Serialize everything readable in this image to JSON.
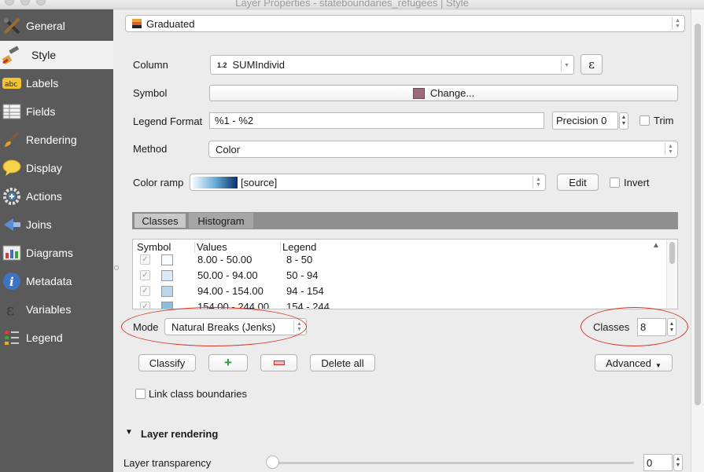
{
  "window": {
    "title": "Layer Properties - stateboundaries_refugees | Style"
  },
  "sidebar": {
    "items": [
      {
        "label": "General",
        "icon": "general-tools-icon"
      },
      {
        "label": "Style",
        "icon": "style-brush-icon",
        "active": true
      },
      {
        "label": "Labels",
        "icon": "labels-abc-icon"
      },
      {
        "label": "Fields",
        "icon": "fields-table-icon"
      },
      {
        "label": "Rendering",
        "icon": "rendering-brush-icon"
      },
      {
        "label": "Display",
        "icon": "display-speech-icon"
      },
      {
        "label": "Actions",
        "icon": "actions-gear-icon"
      },
      {
        "label": "Joins",
        "icon": "joins-icon"
      },
      {
        "label": "Diagrams",
        "icon": "diagrams-icon"
      },
      {
        "label": "Metadata",
        "icon": "metadata-info-icon"
      },
      {
        "label": "Variables",
        "icon": "variables-epsilon-icon"
      },
      {
        "label": "Legend",
        "icon": "legend-icon"
      }
    ]
  },
  "style": {
    "renderer": "Graduated",
    "column_label": "Column",
    "column_type": "1.2",
    "column_value": "SUMIndivid",
    "expression_button": "ε",
    "symbol_label": "Symbol",
    "symbol_button": "Change...",
    "symbol_color": "#9e6a7a",
    "legend_format_label": "Legend Format",
    "legend_format_value": "%1 - %2",
    "precision_label": "Precision 0",
    "trim_label": "Trim",
    "method_label": "Method",
    "method_value": "Color",
    "color_ramp_label": "Color ramp",
    "color_ramp_value": "[source]",
    "edit_button": "Edit",
    "invert_label": "Invert"
  },
  "tabs": [
    {
      "label": "Classes",
      "active": true
    },
    {
      "label": "Histogram",
      "active": false
    }
  ],
  "table": {
    "headers": {
      "symbol": "Symbol",
      "values": "Values",
      "legend": "Legend"
    },
    "rows": [
      {
        "values": "8.00 - 50.00",
        "legend": "8 - 50",
        "color": "#f7fbff"
      },
      {
        "values": "50.00 - 94.00",
        "legend": "50 - 94",
        "color": "#dbe9f6"
      },
      {
        "values": "94.00 - 154.00",
        "legend": "94 - 154",
        "color": "#bad6eb"
      },
      {
        "values": "154.00 - 244.00",
        "legend": "154 - 244",
        "color": "#89bedc"
      }
    ]
  },
  "mode": {
    "label": "Mode",
    "value": "Natural Breaks (Jenks)"
  },
  "classes": {
    "label": "Classes",
    "value": "8"
  },
  "buttons": {
    "classify": "Classify",
    "add": "+",
    "remove": "−",
    "delete_all": "Delete all",
    "advanced": "Advanced"
  },
  "link_class_boundaries": "Link class boundaries",
  "layer_rendering": {
    "section_title": "Layer rendering",
    "transparency_label": "Layer transparency",
    "transparency_value": "0"
  }
}
